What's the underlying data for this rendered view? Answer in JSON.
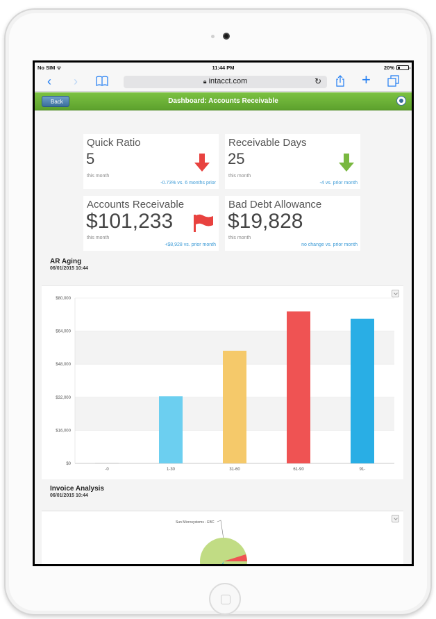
{
  "status_bar": {
    "carrier": "No SIM",
    "time": "11:44 PM",
    "battery": "20%"
  },
  "browser": {
    "url": "intacct.com",
    "icons": [
      "back-icon",
      "forward-icon",
      "bookmarks-icon",
      "lock-icon",
      "reload-icon",
      "share-icon",
      "add-tab-icon",
      "tabs-icon"
    ]
  },
  "header": {
    "back_label": "Back",
    "title": "Dashboard: Accounts Receivable"
  },
  "kpis": [
    {
      "title": "Quick Ratio",
      "value": "5",
      "period": "this month",
      "change": "-0.73% vs. 6 months prior",
      "icon": "arrow-down-icon",
      "icon_color": "#e8423f"
    },
    {
      "title": "Receivable Days",
      "value": "25",
      "period": "this month",
      "change": "-4 vs. prior month",
      "icon": "arrow-down-icon",
      "icon_color": "#79b83f"
    },
    {
      "title": "Accounts Receivable",
      "value": "$101,233",
      "period": "this month",
      "change": "+$8,928 vs. prior month",
      "icon": "flag-icon",
      "icon_color": "#e8423f"
    },
    {
      "title": "Bad Debt Allowance",
      "value": "$19,828",
      "period": "this month",
      "change": "no change vs. prior month",
      "icon": "",
      "icon_color": ""
    }
  ],
  "ar_aging": {
    "title": "AR Aging",
    "date": "06/01/2015 10:44"
  },
  "invoice_analysis": {
    "title": "Invoice Analysis",
    "date": "06/01/2015 10:44",
    "pie_label": "Sun Microsystems - EBC"
  },
  "chart_data": {
    "type": "bar",
    "categories": [
      "-0",
      "1-30",
      "31-60",
      "61-90",
      "91-"
    ],
    "values": [
      0,
      32500,
      54500,
      73500,
      70000
    ],
    "colors": [
      "#ccc",
      "#6ccff0",
      "#f5c96a",
      "#ef5353",
      "#29aee5"
    ],
    "y_ticks": [
      "$0",
      "$16,000",
      "$32,000",
      "$48,000",
      "$64,000",
      "$80,000"
    ],
    "ylim": [
      0,
      80000
    ],
    "grid": true,
    "title": "",
    "xlabel": "",
    "ylabel": ""
  }
}
